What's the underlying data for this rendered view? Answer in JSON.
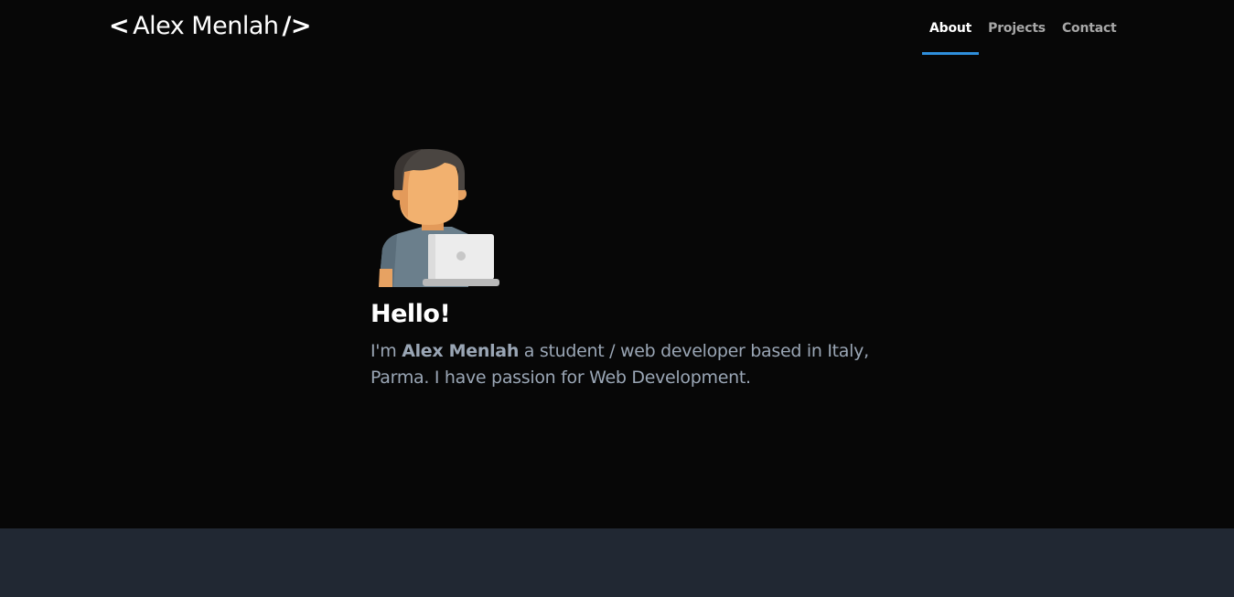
{
  "header": {
    "logo": {
      "open_bracket": "<",
      "name": "Alex Menlah",
      "close_bracket": "/>"
    },
    "nav": {
      "items": [
        {
          "label": "About",
          "active": true
        },
        {
          "label": "Projects",
          "active": false
        },
        {
          "label": "Contact",
          "active": false
        }
      ]
    }
  },
  "about": {
    "avatar_icon": "developer-with-laptop-illustration",
    "greeting": "Hello!",
    "bio": {
      "prefix": "I'm ",
      "name": "Alex Menlah",
      "suffix": " a student / web developer based in Italy, Parma. I have passion for Web Development."
    }
  },
  "colors": {
    "background": "#070707",
    "footer_band": "#212833",
    "accent": "#2f8fdc",
    "nav_inactive": "#a7a7a7",
    "bio_text": "#9aa6b5"
  }
}
